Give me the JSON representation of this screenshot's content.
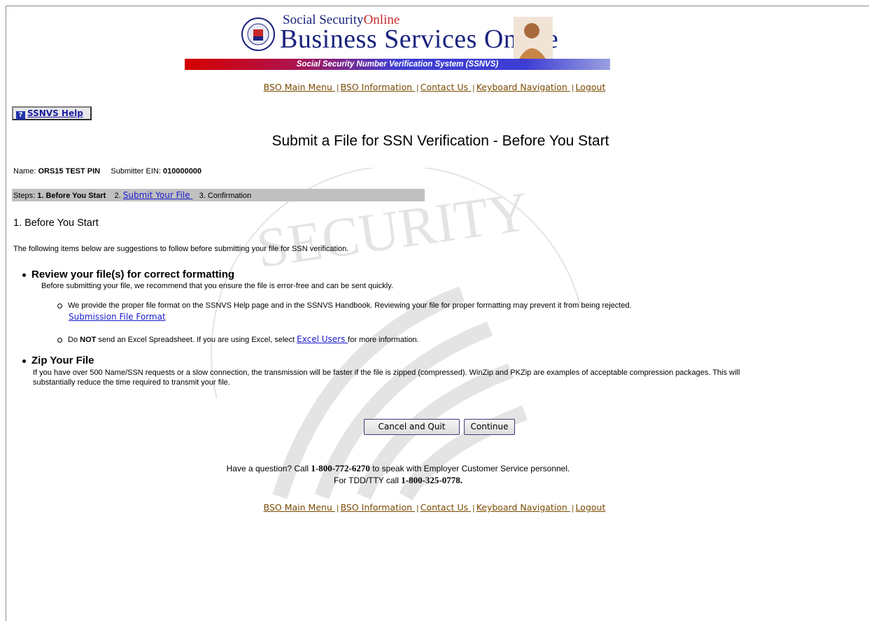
{
  "banner": {
    "brand_top": "Social Security",
    "brand_top_online": "Online",
    "brand_main": "Business Services Online",
    "stripe_text": "Social Security Number Verification System (SSNVS)"
  },
  "nav": {
    "items": [
      "BSO Main Menu ",
      "BSO Information ",
      "Contact Us ",
      "Keyboard Navigation ",
      "Logout"
    ],
    "separator": "|"
  },
  "help_button": {
    "label": "SSNVS Help",
    "icon": "help-question-icon"
  },
  "page_title": "Submit a File for SSN Verification - Before You Start",
  "meta": {
    "name_label": "Name:",
    "name_value": "ORS15 TEST PIN",
    "ein_label": "Submitter EIN:",
    "ein_value": "010000000"
  },
  "steps": {
    "label": "Steps:",
    "step1": "1. Before You Start",
    "step2_num": "2.",
    "step2_link": "Submit Your File ",
    "step3": "3. Confirmation"
  },
  "section_heading": "1. Before You Start",
  "intro": "The following items below are suggestions to follow before submitting your file for SSN verification.",
  "review": {
    "title": "Review your file(s) for correct formatting",
    "desc": "Before submitting your file, we recommend that you ensure the file is error-free and can be sent quickly.",
    "item1_text": "We provide the proper file format on the SSNVS Help page and in the SSNVS Handbook. Reviewing your file for proper formatting may prevent it from being rejected.",
    "item1_link": "Submission File Format",
    "item2_pre": "Do ",
    "item2_bold": "NOT",
    "item2_mid": " send an Excel Spreadsheet. If you are using Excel, select ",
    "item2_link": "Excel Users ",
    "item2_post": "for more information."
  },
  "zip": {
    "title": "Zip Your File",
    "desc_line1": "If you have over 500 Name/SSN requests or a slow connection, the transmission will be faster if the file is zipped (compressed). WinZip and PKZip are examples of acceptable compression packages. This will",
    "desc_line2": "substantially reduce the time required to transmit your file."
  },
  "buttons": {
    "cancel": "Cancel and Quit",
    "continue": "Continue"
  },
  "contact": {
    "line1_pre": "Have a question? Call ",
    "line1_phone": "1-800-772-6270",
    "line1_post": " to speak with Employer Customer Service personnel.",
    "line2_pre": "For TDD/TTY call ",
    "line2_phone": "1-800-325-0778."
  },
  "colors": {
    "nav_link": "#7a4a00",
    "link": "#1a1ad0",
    "brand": "#1a237e",
    "accent_red": "#c62828",
    "steps_bar": "#c0c0c0"
  }
}
